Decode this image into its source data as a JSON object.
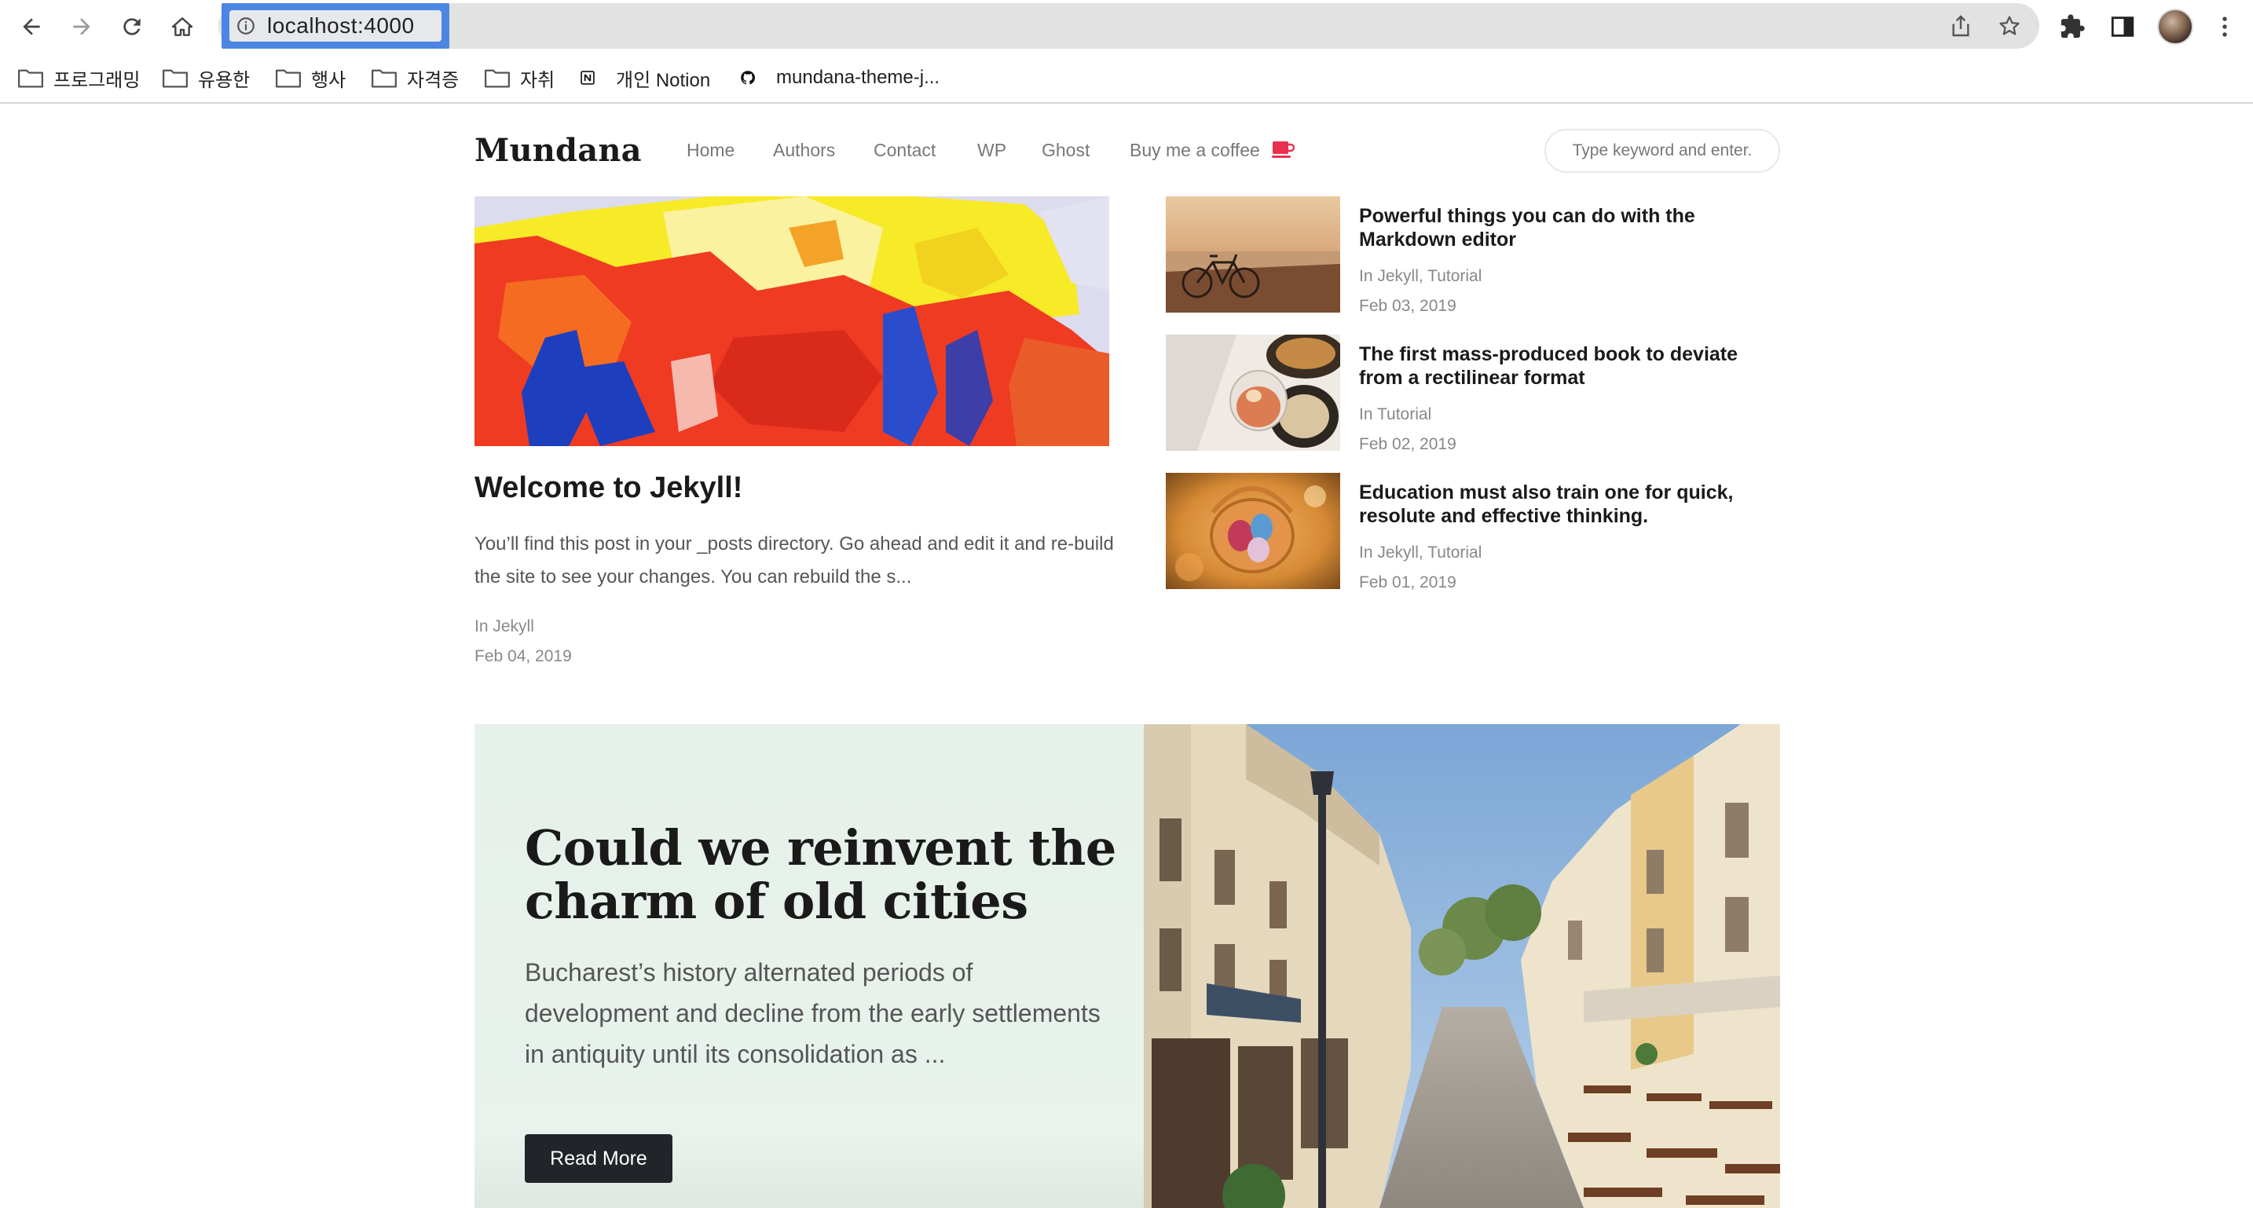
{
  "browser": {
    "url": "localhost:4000",
    "bookmarks": [
      {
        "label": "프로그래밍",
        "icon": "folder-icon"
      },
      {
        "label": "유용한",
        "icon": "folder-icon"
      },
      {
        "label": "행사",
        "icon": "folder-icon"
      },
      {
        "label": "자격증",
        "icon": "folder-icon"
      },
      {
        "label": "자취",
        "icon": "folder-icon"
      },
      {
        "label": "개인 Notion",
        "icon": "notion-icon"
      },
      {
        "label": "mundana-theme-j...",
        "icon": "github-icon"
      }
    ]
  },
  "site": {
    "logo": "Mundana",
    "menu": [
      "Home",
      "Authors",
      "Contact",
      "WP",
      "Ghost",
      "Buy me a coffee"
    ],
    "search_placeholder": "Type keyword and enter.",
    "featured": {
      "title": "Welcome to Jekyll!",
      "excerpt": "You’ll find this post in your _posts directory. Go ahead and edit it and re-build the site to see your changes. You can rebuild the s...",
      "category": "In Jekyll",
      "date": "Feb 04, 2019"
    },
    "side_posts": [
      {
        "title": "Powerful things you can do with the Markdown editor",
        "category": "In Jekyll, Tutorial",
        "date": "Feb 03, 2019"
      },
      {
        "title": "The first mass-produced book to deviate from a rectilinear format",
        "category": "In Tutorial",
        "date": "Feb 02, 2019"
      },
      {
        "title": "Education must also train one for quick, resolute and effective thinking.",
        "category": "In Jekyll, Tutorial",
        "date": "Feb 01, 2019"
      }
    ],
    "jumbotron": {
      "title": "Could we reinvent the charm of old cities",
      "text": "Bucharest’s history alternated periods of development and decline from the early settlements in antiquity until its consolidation as ...",
      "button": "Read More"
    }
  },
  "colors": {
    "url_highlight": "#4d86e2",
    "jumbotron_bg": "#e5f0ea",
    "button_bg": "#212529",
    "coffee_icon": "#e8314f"
  }
}
